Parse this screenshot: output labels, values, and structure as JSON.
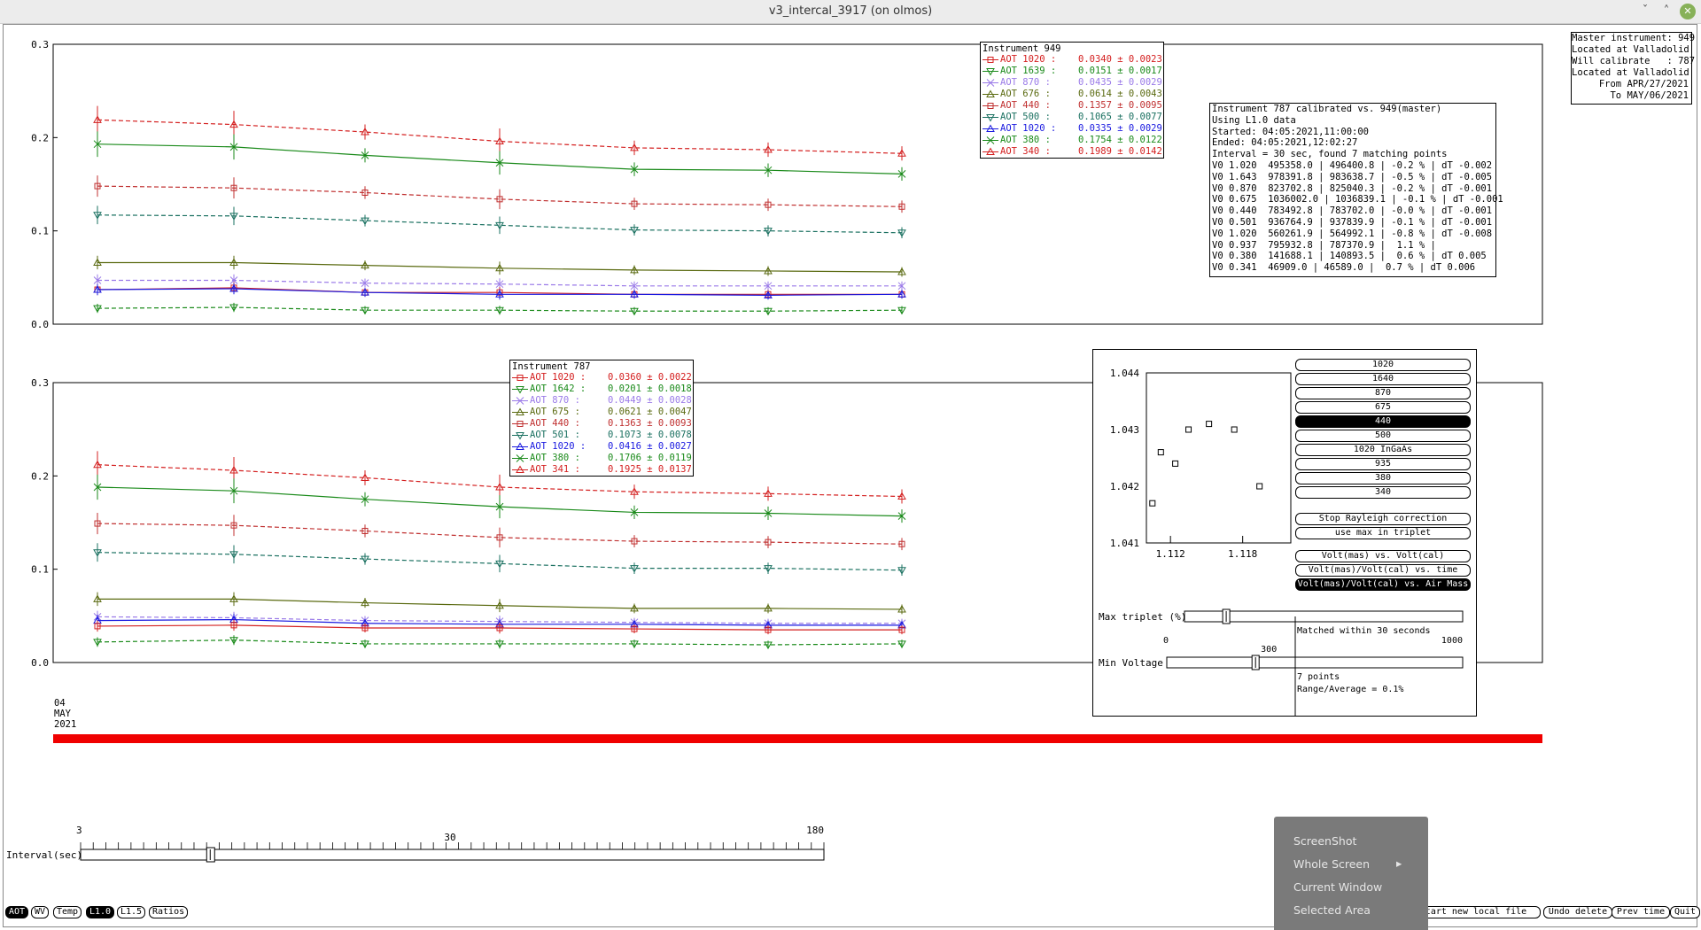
{
  "window": {
    "title": "v3_intercal_3917 (on olmos)",
    "minimize_glyph": "ˇ",
    "maximize_glyph": "˄",
    "close_glyph": "✕"
  },
  "plot_top": {
    "y_ticks": [
      "0.3",
      "0.2",
      "0.1",
      "0.0"
    ],
    "legend_title": "Instrument 949",
    "legend": [
      {
        "label": "AOT 1020 :",
        "value": "0.0340 ± 0.0023",
        "color": "#d42020",
        "marker": "square"
      },
      {
        "label": "AOT 1639 :",
        "value": "0.0151 ± 0.0017",
        "color": "#1a8a1a",
        "marker": "triangle-down"
      },
      {
        "label": "AOT 870 :",
        "value": "0.0435 ± 0.0029",
        "color": "#9a7ae8",
        "marker": "x"
      },
      {
        "label": "AOT 676 :",
        "value": "0.0614 ± 0.0043",
        "color": "#5a6a10",
        "marker": "triangle"
      },
      {
        "label": "AOT 440 :",
        "value": "0.1357 ± 0.0095",
        "color": "#c03030",
        "marker": "square"
      },
      {
        "label": "AOT 500 :",
        "value": "0.1065 ± 0.0077",
        "color": "#1a7060",
        "marker": "triangle-down"
      },
      {
        "label": "AOT 1020 :",
        "value": "0.0335 ± 0.0029",
        "color": "#1a1ae0",
        "marker": "triangle"
      },
      {
        "label": "AOT 380 :",
        "value": "0.1754 ± 0.0122",
        "color": "#1a8a1a",
        "marker": "x"
      },
      {
        "label": "AOT 340 :",
        "value": "0.1989 ± 0.0142",
        "color": "#d42020",
        "marker": "triangle"
      }
    ],
    "info_lines": [
      "Instrument 787 calibrated vs. 949(master)",
      "Using L1.0 data",
      "Started: 04:05:2021,11:00:00",
      "Ended: 04:05:2021,12:02:27",
      "Interval = 30 sec, found 7 matching points",
      "V0 1.020  495358.0 | 496400.8 | -0.2 % | dT -0.002",
      "V0 1.643  978391.8 | 983638.7 | -0.5 % | dT -0.005",
      "V0 0.870  823702.8 | 825040.3 | -0.2 % | dT -0.001",
      "V0 0.675  1036002.0 | 1036839.1 | -0.1 % | dT -0.001",
      "V0 0.440  783492.8 | 783702.0 | -0.0 % | dT -0.001",
      "V0 0.501  936764.9 | 937839.9 | -0.1 % | dT -0.001",
      "V0 1.020  560261.9 | 564992.1 | -0.8 % | dT -0.008",
      "V0 0.937  795932.8 | 787370.9 |  1.1 % |",
      "V0 0.380  141688.1 | 140893.5 |  0.6 % | dT 0.005",
      "V0 0.341  46909.0 | 46589.0 |  0.7 % | dT 0.006"
    ]
  },
  "plot_bottom": {
    "y_ticks": [
      "0.3",
      "0.2",
      "0.1",
      "0.0"
    ],
    "legend_title": "Instrument 787",
    "legend": [
      {
        "label": "AOT 1020 :",
        "value": "0.0360 ± 0.0022",
        "color": "#d42020",
        "marker": "square"
      },
      {
        "label": "AOT 1642 :",
        "value": "0.0201 ± 0.0018",
        "color": "#1a8a1a",
        "marker": "triangle-down"
      },
      {
        "label": "AOT 870 :",
        "value": "0.0449 ± 0.0028",
        "color": "#9a7ae8",
        "marker": "x"
      },
      {
        "label": "AOT 675 :",
        "value": "0.0621 ± 0.0047",
        "color": "#5a6a10",
        "marker": "triangle"
      },
      {
        "label": "AOT 440 :",
        "value": "0.1363 ± 0.0093",
        "color": "#c03030",
        "marker": "square"
      },
      {
        "label": "AOT 501 :",
        "value": "0.1073 ± 0.0078",
        "color": "#1a7060",
        "marker": "triangle-down"
      },
      {
        "label": "AOT 1020 :",
        "value": "0.0416 ± 0.0027",
        "color": "#1a1ae0",
        "marker": "triangle"
      },
      {
        "label": "AOT 380 :",
        "value": "0.1706 ± 0.0119",
        "color": "#1a8a1a",
        "marker": "x"
      },
      {
        "label": "AOT 341 :",
        "value": "0.1925 ± 0.0137",
        "color": "#d42020",
        "marker": "triangle"
      }
    ]
  },
  "master_box": [
    "Master instrument: 949",
    "Located at Valladolid",
    "Will calibrate   : 787",
    "Located at Valladolid",
    "From APR/27/2021",
    "To MAY/06/2021"
  ],
  "date_label": {
    "day": "04",
    "month": "MAY",
    "year": "2021"
  },
  "colors": {
    "timeline_bar": "#f00000"
  },
  "chart_data": [
    {
      "type": "line",
      "ylim": [
        0,
        0.3
      ],
      "x": [
        1,
        2,
        3,
        4,
        5,
        6,
        7
      ],
      "series": [
        {
          "name": "AOT 340",
          "color": "#d42020",
          "dash": true,
          "values": [
            0.219,
            0.214,
            0.206,
            0.196,
            0.189,
            0.187,
            0.183
          ]
        },
        {
          "name": "AOT 380",
          "color": "#1a8a1a",
          "dash": false,
          "values": [
            0.193,
            0.19,
            0.181,
            0.173,
            0.166,
            0.165,
            0.161
          ]
        },
        {
          "name": "AOT 440",
          "color": "#c03030",
          "dash": true,
          "values": [
            0.148,
            0.146,
            0.141,
            0.134,
            0.129,
            0.128,
            0.126
          ]
        },
        {
          "name": "AOT 500",
          "color": "#1a7060",
          "dash": true,
          "values": [
            0.117,
            0.116,
            0.111,
            0.106,
            0.101,
            0.1,
            0.098
          ]
        },
        {
          "name": "AOT 676",
          "color": "#5a6a10",
          "dash": false,
          "values": [
            0.066,
            0.066,
            0.063,
            0.06,
            0.058,
            0.057,
            0.056
          ]
        },
        {
          "name": "AOT 870",
          "color": "#9a7ae8",
          "dash": true,
          "values": [
            0.047,
            0.047,
            0.044,
            0.043,
            0.041,
            0.041,
            0.041
          ]
        },
        {
          "name": "AOT 1020",
          "color": "#d42020",
          "dash": false,
          "values": [
            0.037,
            0.039,
            0.034,
            0.034,
            0.032,
            0.032,
            0.032
          ]
        },
        {
          "name": "AOT 1020",
          "color": "#1a1ae0",
          "dash": false,
          "values": [
            0.037,
            0.038,
            0.034,
            0.032,
            0.032,
            0.031,
            0.032
          ]
        },
        {
          "name": "AOT 1639",
          "color": "#1a8a1a",
          "dash": true,
          "values": [
            0.017,
            0.018,
            0.015,
            0.015,
            0.014,
            0.014,
            0.015
          ]
        }
      ]
    },
    {
      "type": "line",
      "ylim": [
        0,
        0.3
      ],
      "x": [
        1,
        2,
        3,
        4,
        5,
        6,
        7
      ],
      "series": [
        {
          "name": "AOT 341",
          "color": "#d42020",
          "dash": true,
          "values": [
            0.212,
            0.206,
            0.198,
            0.188,
            0.183,
            0.181,
            0.178
          ]
        },
        {
          "name": "AOT 380",
          "color": "#1a8a1a",
          "dash": false,
          "values": [
            0.188,
            0.184,
            0.175,
            0.167,
            0.161,
            0.16,
            0.157
          ]
        },
        {
          "name": "AOT 440",
          "color": "#c03030",
          "dash": true,
          "values": [
            0.149,
            0.147,
            0.141,
            0.134,
            0.13,
            0.129,
            0.127
          ]
        },
        {
          "name": "AOT 501",
          "color": "#1a7060",
          "dash": true,
          "values": [
            0.118,
            0.116,
            0.111,
            0.106,
            0.101,
            0.101,
            0.099
          ]
        },
        {
          "name": "AOT 675",
          "color": "#5a6a10",
          "dash": false,
          "values": [
            0.068,
            0.068,
            0.064,
            0.061,
            0.058,
            0.058,
            0.057
          ]
        },
        {
          "name": "AOT 870",
          "color": "#9a7ae8",
          "dash": true,
          "values": [
            0.049,
            0.048,
            0.045,
            0.044,
            0.043,
            0.042,
            0.042
          ]
        },
        {
          "name": "AOT 1020",
          "color": "#1a1ae0",
          "dash": false,
          "values": [
            0.045,
            0.046,
            0.042,
            0.041,
            0.041,
            0.04,
            0.04
          ]
        },
        {
          "name": "AOT 1020",
          "color": "#d42020",
          "dash": false,
          "values": [
            0.039,
            0.04,
            0.037,
            0.037,
            0.036,
            0.035,
            0.035
          ]
        },
        {
          "name": "AOT 1642",
          "color": "#1a8a1a",
          "dash": true,
          "values": [
            0.022,
            0.024,
            0.02,
            0.02,
            0.02,
            0.019,
            0.02
          ]
        }
      ]
    },
    {
      "type": "scatter",
      "x_ticks": [
        "1.112",
        "1.118"
      ],
      "y_ticks": [
        "1.044",
        "1.043",
        "1.042",
        "1.041"
      ],
      "xlim": [
        1.11,
        1.122
      ],
      "ylim": [
        1.041,
        1.044
      ],
      "x": [
        1.1105,
        1.1112,
        1.1124,
        1.1135,
        1.1152,
        1.1173,
        1.1194
      ],
      "values": [
        1.0417,
        1.0426,
        1.0424,
        1.043,
        1.0431,
        1.043,
        1.042
      ]
    }
  ],
  "wave_buttons": [
    {
      "label": "1020",
      "selected": false
    },
    {
      "label": "1640",
      "selected": false
    },
    {
      "label": "870",
      "selected": false
    },
    {
      "label": "675",
      "selected": false
    },
    {
      "label": "440",
      "selected": true
    },
    {
      "label": "500",
      "selected": false
    },
    {
      "label": "1020 InGaAs",
      "selected": false
    },
    {
      "label": "935",
      "selected": false
    },
    {
      "label": "380",
      "selected": false
    },
    {
      "label": "340",
      "selected": false
    }
  ],
  "option_buttons": {
    "rayleigh": "Stop Rayleigh correction",
    "max_triplet": "use max in triplet"
  },
  "mode_buttons": [
    {
      "label": "Volt(mas) vs. Volt(cal)",
      "selected": false
    },
    {
      "label": "Volt(mas)/Volt(cal) vs. time",
      "selected": false
    },
    {
      "label": "Volt(mas)/Volt(cal) vs. Air Mass",
      "selected": true
    }
  ],
  "slider_triplet": {
    "label": "Max triplet (%)",
    "min": "0",
    "mid": "15",
    "max": "100",
    "value": 15,
    "note": "Matched within 30 seconds"
  },
  "slider_voltage": {
    "label": "Min Voltage",
    "min": "0",
    "mid": "300",
    "max": "1000",
    "value": 300,
    "note1": "7 points",
    "note2": "Range/Average = 0.1%"
  },
  "interval_slider": {
    "label": "Interval(sec)",
    "min": "3",
    "mid": "30",
    "max": "180",
    "value": 30
  },
  "bottom_tabs": [
    {
      "label": "AOT",
      "selected": true
    },
    {
      "label": "WV",
      "selected": false
    },
    {
      "label": "Temp",
      "selected": false
    },
    {
      "label": "L1.0",
      "selected": true
    },
    {
      "label": "L1.5",
      "selected": false
    },
    {
      "label": "Ratios",
      "selected": false
    }
  ],
  "action_buttons": {
    "new_file": "Start new local file",
    "undo": "Undo delete",
    "prev": "Prev time",
    "quit": "Quit"
  },
  "context_menu": {
    "items": [
      "ScreenShot",
      "Whole Screen",
      "Current Window",
      "Selected Area"
    ],
    "submenu_arrow": "▸"
  }
}
